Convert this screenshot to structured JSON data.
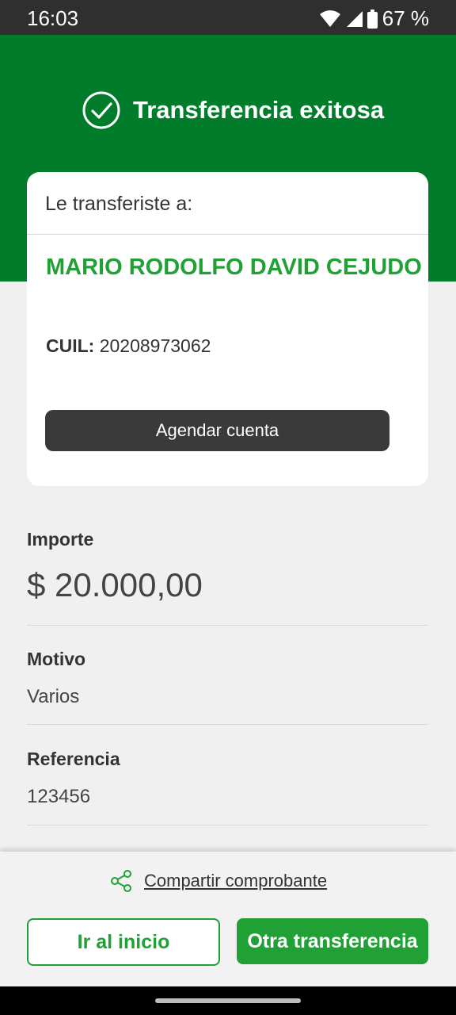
{
  "status_bar": {
    "time": "16:03",
    "battery": "67 %"
  },
  "header": {
    "title": "Transferencia exitosa"
  },
  "card": {
    "header_label": "Le transferiste a:",
    "recipient_name": "MARIO RODOLFO DAVID CEJUDO",
    "cuil_label": "CUIL:",
    "cuil_value": "20208973062",
    "agendar_label": "Agendar cuenta"
  },
  "details": {
    "importe_label": "Importe",
    "importe_value": "$ 20.000,00",
    "motivo_label": "Motivo",
    "motivo_value": "Varios",
    "referencia_label": "Referencia",
    "referencia_value": "123456"
  },
  "footer": {
    "share_label": "Compartir comprobante",
    "home_button": "Ir al inicio",
    "new_transfer_button": "Otra transferencia"
  },
  "colors": {
    "header_green": "#007c2b",
    "accent_green": "#21a035",
    "dark_button": "#3a3a3a"
  }
}
